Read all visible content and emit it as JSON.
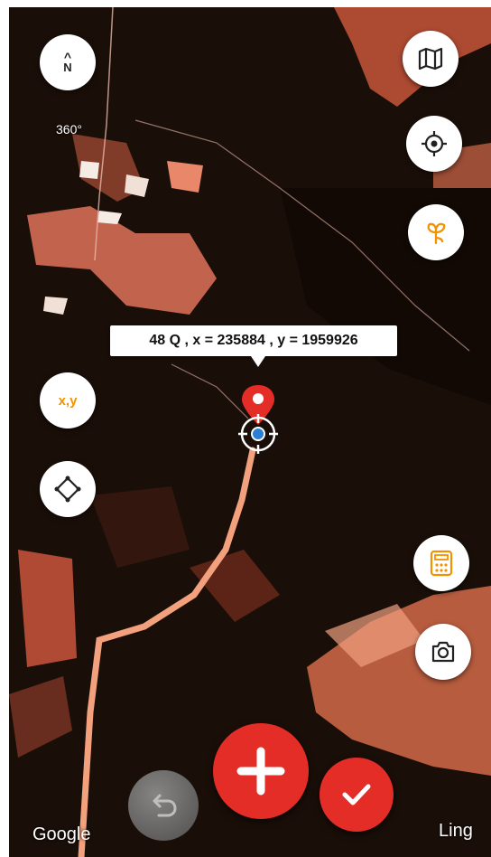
{
  "compass": {
    "north_label": "N",
    "bearing": "360°"
  },
  "coordinates": {
    "text": "48 Q , x = 235884 , y = 1959926"
  },
  "controls": {
    "xy_label": "x,y"
  },
  "map_attribution": "Google",
  "brand": "Ling",
  "colors": {
    "accent_red": "#e52d27",
    "accent_orange": "#f39200"
  }
}
